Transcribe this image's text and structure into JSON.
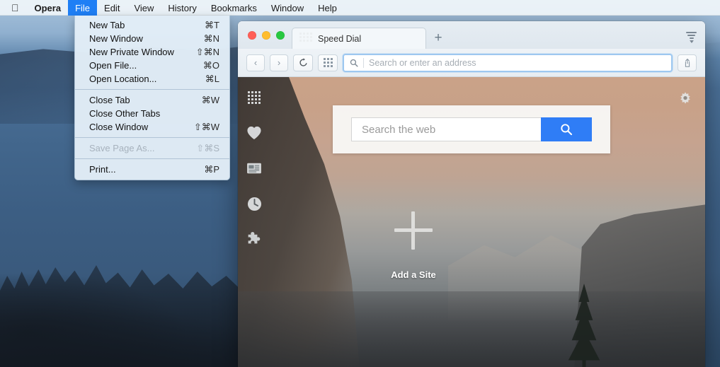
{
  "menubar": {
    "apple_icon": "apple-logo",
    "items": [
      {
        "label": "Opera",
        "bold": true,
        "active": false
      },
      {
        "label": "File",
        "bold": false,
        "active": true
      },
      {
        "label": "Edit",
        "bold": false,
        "active": false
      },
      {
        "label": "View",
        "bold": false,
        "active": false
      },
      {
        "label": "History",
        "bold": false,
        "active": false
      },
      {
        "label": "Bookmarks",
        "bold": false,
        "active": false
      },
      {
        "label": "Window",
        "bold": false,
        "active": false
      },
      {
        "label": "Help",
        "bold": false,
        "active": false
      }
    ]
  },
  "file_menu": {
    "groups": [
      [
        {
          "label": "New Tab",
          "shortcut": "⌘T",
          "disabled": false
        },
        {
          "label": "New Window",
          "shortcut": "⌘N",
          "disabled": false
        },
        {
          "label": "New Private Window",
          "shortcut": "⇧⌘N",
          "disabled": false
        },
        {
          "label": "Open File...",
          "shortcut": "⌘O",
          "disabled": false
        },
        {
          "label": "Open Location...",
          "shortcut": "⌘L",
          "disabled": false
        }
      ],
      [
        {
          "label": "Close Tab",
          "shortcut": "⌘W",
          "disabled": false
        },
        {
          "label": "Close Other Tabs",
          "shortcut": "",
          "disabled": false
        },
        {
          "label": "Close Window",
          "shortcut": "⇧⌘W",
          "disabled": false
        }
      ],
      [
        {
          "label": "Save Page As...",
          "shortcut": "⇧⌘S",
          "disabled": true
        }
      ],
      [
        {
          "label": "Print...",
          "shortcut": "⌘P",
          "disabled": false
        }
      ]
    ]
  },
  "browser": {
    "tab": {
      "title": "Speed Dial",
      "favicon": "speed-dial-grid-icon"
    },
    "new_tab_label": "+",
    "easy_setup_label": "easy-setup-icon",
    "toolbar": {
      "back_label": "‹",
      "forward_label": "›",
      "reload_label": "↻",
      "speeddial_label": "speed-dial-icon",
      "share_label": "share-icon"
    },
    "address_bar": {
      "placeholder": "Search or enter an address",
      "value": "",
      "search_icon": "magnifier-icon"
    }
  },
  "speed_dial": {
    "sidebar": [
      {
        "name": "speed-dial",
        "icon": "grid-icon"
      },
      {
        "name": "bookmarks",
        "icon": "heart-icon"
      },
      {
        "name": "news",
        "icon": "newspaper-icon"
      },
      {
        "name": "history",
        "icon": "clock-icon"
      },
      {
        "name": "extensions",
        "icon": "puzzle-icon"
      }
    ],
    "settings_icon": "gear-icon",
    "search": {
      "placeholder": "Search the web",
      "value": "",
      "button_icon": "magnifier-icon",
      "button_color": "#2f7df6"
    },
    "add_site": {
      "label": "Add a Site",
      "icon": "plus-icon"
    }
  },
  "colors": {
    "accent_blue": "#1f7ff5",
    "search_button": "#2f7df6",
    "traffic_red": "#ff5f57",
    "traffic_yellow": "#ffbd2e",
    "traffic_green": "#28c840"
  }
}
